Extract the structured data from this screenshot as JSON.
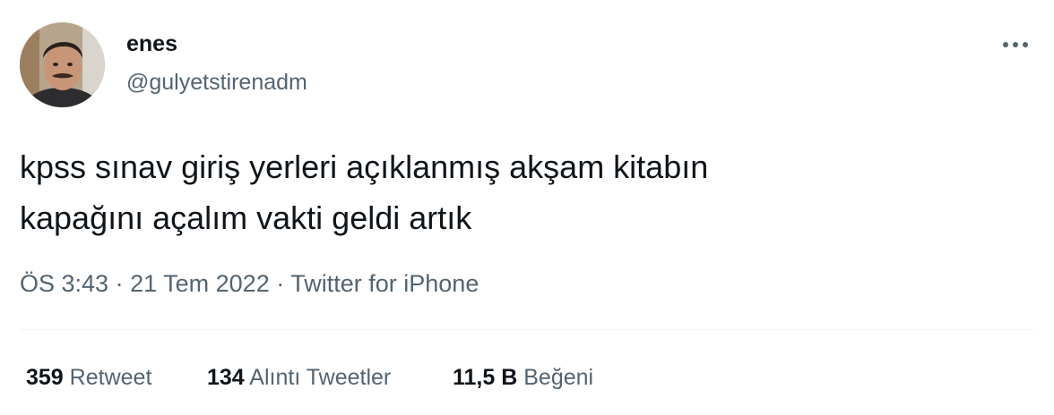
{
  "tweet": {
    "author": {
      "display_name": "enes",
      "handle": "@gulyetstirenadm"
    },
    "text": "kpss sınav giriş yerleri açıklanmış akşam kitabın\nkapağını açalım vakti geldi artık",
    "meta": {
      "time": "ÖS 3:43",
      "separator": "·",
      "date": "21 Tem 2022",
      "source": "Twitter for iPhone"
    },
    "stats": {
      "retweets": {
        "count": "359",
        "label": "Retweet"
      },
      "quotes": {
        "count": "134",
        "label": "Alıntı Tweetler"
      },
      "likes": {
        "count": "11,5 B",
        "label": "Beğeni"
      }
    }
  },
  "icons": {
    "more": "more-horizontal-icon"
  },
  "colors": {
    "text_primary": "#0f1419",
    "text_secondary": "#536471",
    "divider": "#eff3f4"
  }
}
